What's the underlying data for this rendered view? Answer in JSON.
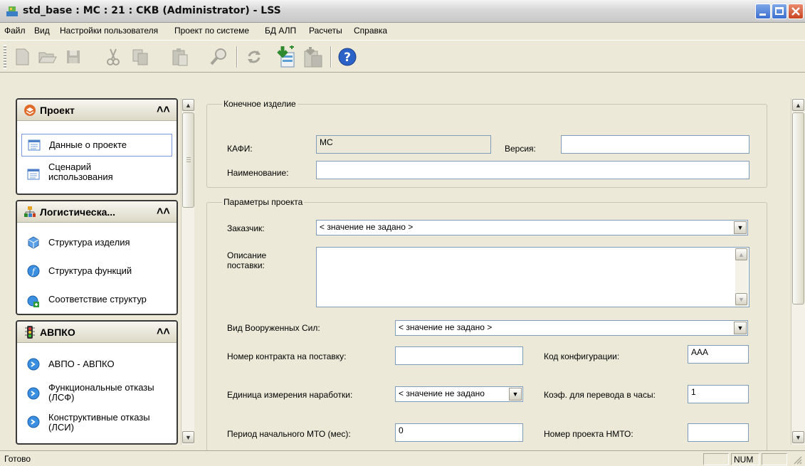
{
  "window": {
    "title": "std_base : MC : 21 : СКВ (Administrator) - LSS"
  },
  "menu": [
    "Файл",
    "Вид",
    "Настройки пользователя",
    "Проект по системе",
    "БД АЛП",
    "Расчеты",
    "Справка"
  ],
  "toolbar": {
    "buttons": [
      "new-icon",
      "open-icon",
      "save-icon",
      "cut-icon",
      "copy-icon",
      "paste-icon",
      "find-icon",
      "refresh-icon",
      "import-icon",
      "export-icon",
      "help-icon"
    ]
  },
  "sidebar": {
    "groups": [
      {
        "title": "Проект",
        "items": [
          {
            "label": "Данные о проекте",
            "selected": true
          },
          {
            "label": "Сценарий использования"
          }
        ]
      },
      {
        "title": "Логистическа...",
        "items": [
          {
            "label": "Структура изделия"
          },
          {
            "label": "Структура функций"
          },
          {
            "label": "Соответствие структур"
          }
        ]
      },
      {
        "title": "АВПКО",
        "items": [
          {
            "label": "АВПО - АВПКО"
          },
          {
            "label": "Функциональные отказы (ЛСФ)"
          },
          {
            "label": "Конструктивные отказы (ЛСИ)"
          }
        ]
      }
    ]
  },
  "form": {
    "end_product": {
      "legend": "Конечное изделие",
      "kafi_label": "КАФИ:",
      "kafi_value": "MC",
      "version_label": "Версия:",
      "version_value": "",
      "name_label": "Наименование:",
      "name_value": ""
    },
    "project_params": {
      "legend": "Параметры проекта",
      "customer_label": "Заказчик:",
      "customer_value": "< значение не задано >",
      "delivery_desc_label": "Описание поставки:",
      "delivery_desc_value": "",
      "armed_forces_label": "Вид Вооруженных Сил:",
      "armed_forces_value": "< значение не задано >",
      "contract_label": "Номер контракта на поставку:",
      "contract_value": "",
      "config_code_label": "Код конфигурации:",
      "config_code_value": "AAA",
      "unit_label": "Единица измерения наработки:",
      "unit_value": "< значение не задано",
      "coef_label": "Коэф. для перевода в часы:",
      "coef_value": "1",
      "period_label": "Период начального МТО (мес):",
      "period_value": "0",
      "nmto_label": "Номер проекта НМТО:",
      "nmto_value": ""
    }
  },
  "status": {
    "text": "Готово",
    "num": "NUM"
  },
  "colors": {
    "chrome": "#ece9d8",
    "border": "#7f9db9",
    "selection": "#7a96df"
  }
}
